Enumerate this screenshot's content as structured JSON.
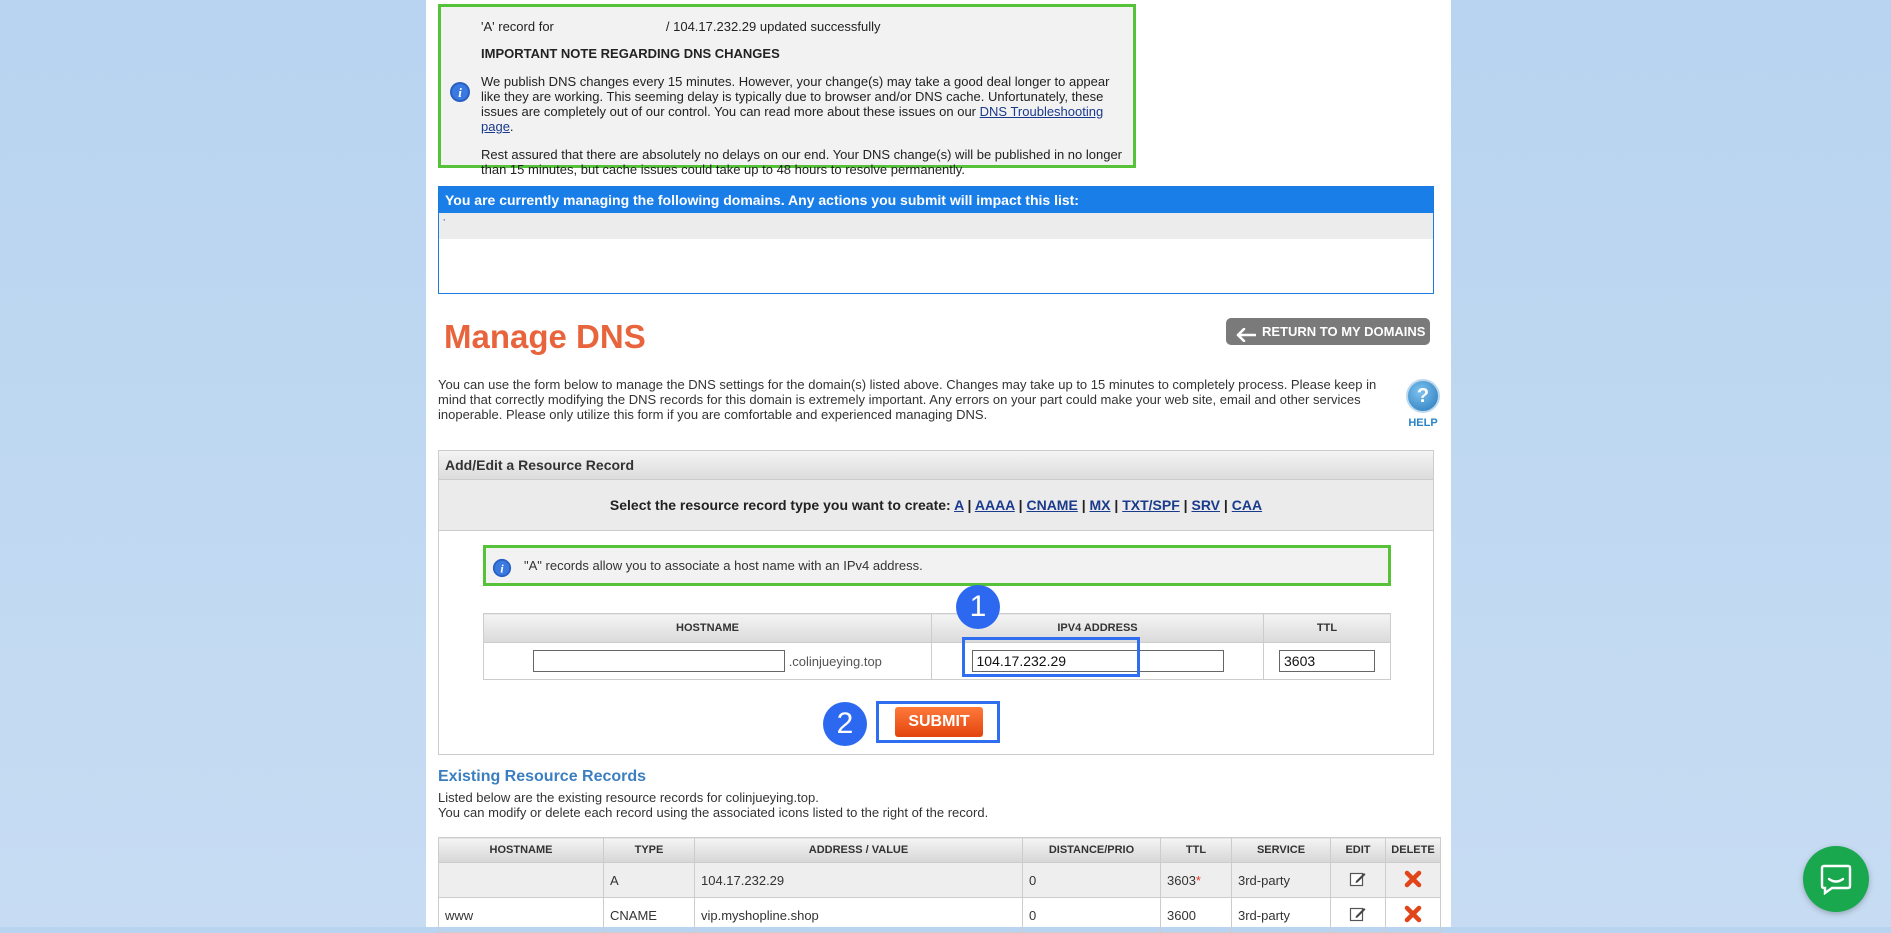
{
  "notice": {
    "line1_prefix": "'A' record for",
    "line1_suffix": "/ 104.17.232.29 updated successfully",
    "title": "IMPORTANT NOTE REGARDING DNS CHANGES",
    "para1": "We publish DNS changes every 15 minutes. However, your change(s) may take a good deal longer to appear like they are working. This seeming delay is typically due to browser and/or DNS cache. Unfortunately, these issues are completely out of our control. You can read more about these issues on our",
    "para1_link": "DNS Troubleshooting page",
    "para2": "Rest assured that there are absolutely no delays on our end. Your DNS change(s) will be published in no longer than 15 minutes, but cache issues could take up to 48 hours to resolve permanently."
  },
  "domains": {
    "header": "You are currently managing the following domains. Any actions you submit will impact this list:",
    "row_text": ","
  },
  "manage": {
    "title": "Manage DNS",
    "return_button": "RETURN TO MY DOMAINS",
    "intro": "You can use the form below to manage the DNS settings for the domain(s) listed above. Changes may take up to 15 minutes to completely process. Please keep in mind that correctly modifying the DNS records for this domain is extremely important. Any errors on your part could make your web site, email and other services inoperable. Please only utilize this form if you are comfortable and experienced managing DNS.",
    "help_label": "HELP",
    "help_symbol": "?"
  },
  "rr": {
    "header": "Add/Edit a Resource Record",
    "select_label": "Select the resource record type you want to create:",
    "types": [
      "A",
      "AAAA",
      "CNAME",
      "MX",
      "TXT/SPF",
      "SRV",
      "CAA"
    ],
    "a_note": "\"A\" records allow you to associate a host name with an IPv4 address.",
    "columns": [
      "HOSTNAME",
      "IPV4 ADDRESS",
      "TTL"
    ],
    "hostname_value": "",
    "domain_suffix": ".colinjueying.top",
    "ipv4_value": "104.17.232.29",
    "ttl_value": "3603",
    "submit": "SUBMIT"
  },
  "annotations": {
    "badge1": "1",
    "badge2": "2"
  },
  "existing": {
    "title": "Existing Resource Records",
    "desc1": "Listed below are the existing resource records for colinjueying.top.",
    "desc2": "You can modify or delete each record using the associated icons listed to the right of the record.",
    "columns": [
      "HOSTNAME",
      "TYPE",
      "ADDRESS / VALUE",
      "DISTANCE/PRIO",
      "TTL",
      "SERVICE",
      "EDIT",
      "DELETE"
    ],
    "rows": [
      {
        "hostname": "",
        "type": "A",
        "value": "104.17.232.29",
        "prio": "0",
        "ttl": "3603",
        "ttl_mark": "*",
        "service": "3rd-party"
      },
      {
        "hostname": "www",
        "type": "CNAME",
        "value": "vip.myshopline.shop",
        "prio": "0",
        "ttl": "3600",
        "ttl_mark": "",
        "service": "3rd-party"
      }
    ]
  },
  "colors": {
    "accent_orange": "#e8643c",
    "highlight_blue": "#2f6ef0",
    "note_green": "#55c23a",
    "chat_green": "#1aa84f"
  },
  "icons": [
    "info-icon",
    "arrow-left-icon",
    "help-icon",
    "edit-icon",
    "delete-icon",
    "chat-icon"
  ]
}
